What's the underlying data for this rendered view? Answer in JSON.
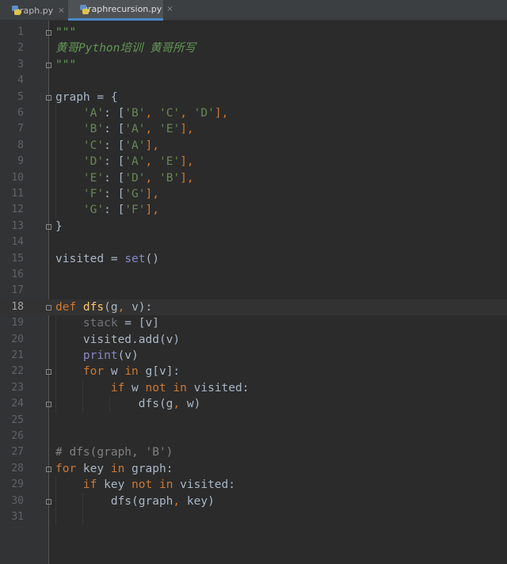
{
  "tabs": [
    {
      "label": "graph.py",
      "active": false
    },
    {
      "label": "graphrecursion.py",
      "active": true
    }
  ],
  "current_line": 18,
  "code_lines": [
    [
      {
        "t": "\"\"\"",
        "c": "doc"
      }
    ],
    [
      {
        "t": "黄哥Python培训 黄哥所写",
        "c": "doc"
      }
    ],
    [
      {
        "t": "\"\"\"",
        "c": "doc"
      }
    ],
    [],
    [
      {
        "t": "graph = {",
        "c": "pl"
      }
    ],
    [
      {
        "t": "    ",
        "c": "pl"
      },
      {
        "t": "'A'",
        "c": "str"
      },
      {
        "t": ": [",
        "c": "pl"
      },
      {
        "t": "'B'",
        "c": "str"
      },
      {
        "t": ", ",
        "c": "op"
      },
      {
        "t": "'C'",
        "c": "str"
      },
      {
        "t": ", ",
        "c": "op"
      },
      {
        "t": "'D'",
        "c": "str"
      },
      {
        "t": "],",
        "c": "op"
      }
    ],
    [
      {
        "t": "    ",
        "c": "pl"
      },
      {
        "t": "'B'",
        "c": "str"
      },
      {
        "t": ": [",
        "c": "pl"
      },
      {
        "t": "'A'",
        "c": "str"
      },
      {
        "t": ", ",
        "c": "op"
      },
      {
        "t": "'E'",
        "c": "str"
      },
      {
        "t": "],",
        "c": "op"
      }
    ],
    [
      {
        "t": "    ",
        "c": "pl"
      },
      {
        "t": "'C'",
        "c": "str"
      },
      {
        "t": ": [",
        "c": "pl"
      },
      {
        "t": "'A'",
        "c": "str"
      },
      {
        "t": "],",
        "c": "op"
      }
    ],
    [
      {
        "t": "    ",
        "c": "pl"
      },
      {
        "t": "'D'",
        "c": "str"
      },
      {
        "t": ": [",
        "c": "pl"
      },
      {
        "t": "'A'",
        "c": "str"
      },
      {
        "t": ", ",
        "c": "op"
      },
      {
        "t": "'E'",
        "c": "str"
      },
      {
        "t": "],",
        "c": "op"
      }
    ],
    [
      {
        "t": "    ",
        "c": "pl"
      },
      {
        "t": "'E'",
        "c": "str"
      },
      {
        "t": ": [",
        "c": "pl"
      },
      {
        "t": "'D'",
        "c": "str"
      },
      {
        "t": ", ",
        "c": "op"
      },
      {
        "t": "'B'",
        "c": "str"
      },
      {
        "t": "],",
        "c": "op"
      }
    ],
    [
      {
        "t": "    ",
        "c": "pl"
      },
      {
        "t": "'F'",
        "c": "str"
      },
      {
        "t": ": [",
        "c": "pl"
      },
      {
        "t": "'G'",
        "c": "str"
      },
      {
        "t": "],",
        "c": "op"
      }
    ],
    [
      {
        "t": "    ",
        "c": "pl"
      },
      {
        "t": "'G'",
        "c": "str"
      },
      {
        "t": ": [",
        "c": "pl"
      },
      {
        "t": "'F'",
        "c": "str"
      },
      {
        "t": "],",
        "c": "op"
      }
    ],
    [
      {
        "t": "}",
        "c": "pl"
      }
    ],
    [],
    [
      {
        "t": "visited = ",
        "c": "pl"
      },
      {
        "t": "set",
        "c": "bi"
      },
      {
        "t": "()",
        "c": "pl"
      }
    ],
    [],
    [],
    [
      {
        "t": "def ",
        "c": "kw"
      },
      {
        "t": "dfs",
        "c": "fn"
      },
      {
        "t": "(g",
        "c": "pl"
      },
      {
        "t": ", ",
        "c": "op"
      },
      {
        "t": "v):",
        "c": "pl"
      }
    ],
    [
      {
        "t": "    ",
        "c": "pl"
      },
      {
        "t": "stack",
        "c": "unused"
      },
      {
        "t": " = [v]",
        "c": "pl"
      }
    ],
    [
      {
        "t": "    visited.add(v)",
        "c": "pl"
      }
    ],
    [
      {
        "t": "    ",
        "c": "pl"
      },
      {
        "t": "print",
        "c": "bi"
      },
      {
        "t": "(v)",
        "c": "pl"
      }
    ],
    [
      {
        "t": "    ",
        "c": "pl"
      },
      {
        "t": "for ",
        "c": "kw"
      },
      {
        "t": "w ",
        "c": "pl"
      },
      {
        "t": "in ",
        "c": "kw"
      },
      {
        "t": "g[v]:",
        "c": "pl"
      }
    ],
    [
      {
        "t": "        ",
        "c": "pl"
      },
      {
        "t": "if ",
        "c": "kw"
      },
      {
        "t": "w ",
        "c": "pl"
      },
      {
        "t": "not in ",
        "c": "kw"
      },
      {
        "t": "visited:",
        "c": "pl"
      }
    ],
    [
      {
        "t": "            dfs(g",
        "c": "pl"
      },
      {
        "t": ", ",
        "c": "op"
      },
      {
        "t": "w)",
        "c": "pl"
      }
    ],
    [],
    [],
    [
      {
        "t": "# dfs(graph, 'B')",
        "c": "cm"
      }
    ],
    [
      {
        "t": "for ",
        "c": "kw"
      },
      {
        "t": "key ",
        "c": "pl"
      },
      {
        "t": "in ",
        "c": "kw"
      },
      {
        "t": "graph:",
        "c": "pl"
      }
    ],
    [
      {
        "t": "    ",
        "c": "pl"
      },
      {
        "t": "if ",
        "c": "kw"
      },
      {
        "t": "key ",
        "c": "pl"
      },
      {
        "t": "not in ",
        "c": "kw"
      },
      {
        "t": "visited:",
        "c": "pl"
      }
    ],
    [
      {
        "t": "        dfs(graph",
        "c": "pl"
      },
      {
        "t": ", ",
        "c": "op"
      },
      {
        "t": "key)",
        "c": "pl"
      }
    ],
    []
  ],
  "fold_lines": [
    1,
    3,
    5,
    13,
    18,
    22,
    24,
    28,
    30
  ],
  "colors": {
    "background": "#2b2b2b",
    "gutter": "#313335",
    "keyword": "#cc7832",
    "string": "#6a8759",
    "docstring": "#629755",
    "function": "#ffc66d",
    "builtin": "#8888c6",
    "comment": "#808080",
    "text": "#a9b7c6"
  }
}
